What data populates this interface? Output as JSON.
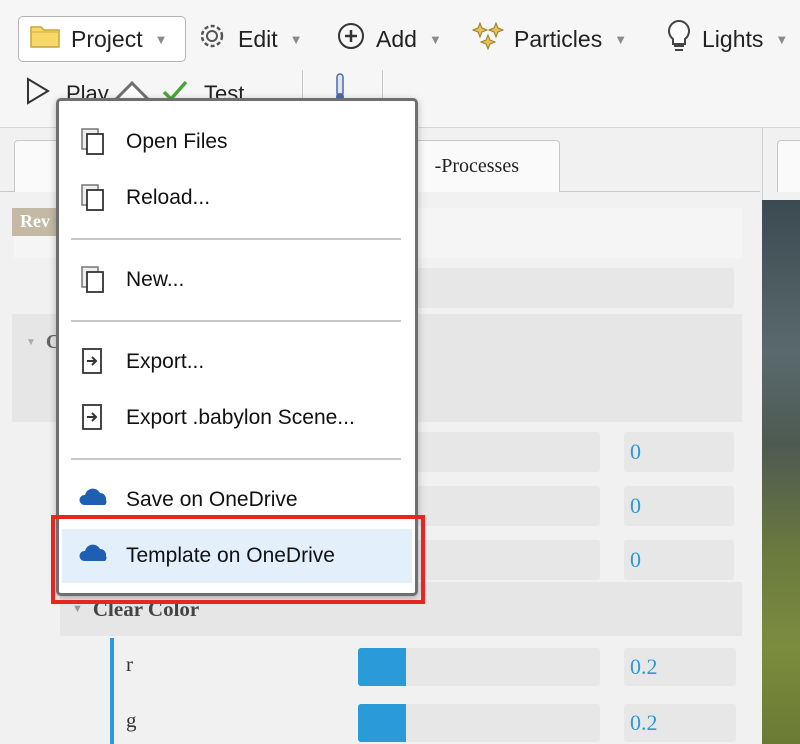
{
  "toolbar": {
    "project_label": "Project",
    "edit_label": "Edit",
    "add_label": "Add",
    "particles_label": "Particles",
    "lights_label": "Lights",
    "play_label": "Play",
    "test_label": "Test"
  },
  "tabs": {
    "tab2_label": "-Processes"
  },
  "panel": {
    "rev_label": "Rev",
    "group_label": "C",
    "values": [
      "0",
      "0",
      "0"
    ],
    "clear_color_label": "Clear Color",
    "color_rows": [
      {
        "channel": "r",
        "value": "0.2",
        "fill": 0.2
      },
      {
        "channel": "g",
        "value": "0.2",
        "fill": 0.2
      }
    ]
  },
  "project_menu": {
    "items": [
      {
        "label": "Open Files",
        "icon": "files-icon"
      },
      {
        "label": "Reload...",
        "icon": "files-icon"
      },
      {
        "label": "New...",
        "icon": "files-icon"
      },
      {
        "label": "Export...",
        "icon": "export-icon"
      },
      {
        "label": "Export .babylon Scene...",
        "icon": "export-icon"
      },
      {
        "label": "Save on OneDrive",
        "icon": "onedrive-cloud-icon"
      },
      {
        "label": "Template on OneDrive",
        "icon": "onedrive-cloud-icon"
      }
    ]
  },
  "colors": {
    "accent": "#2b9ad9",
    "highlight": "#e8251f",
    "onedrive": "#1e5fb4"
  }
}
